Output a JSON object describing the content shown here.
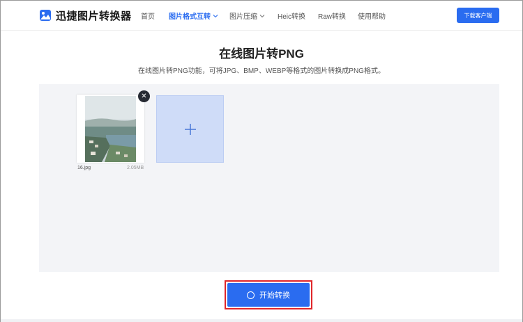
{
  "header": {
    "logo_text": "迅捷图片转换器",
    "nav": [
      {
        "label": "首页",
        "active": false,
        "has_dropdown": false
      },
      {
        "label": "图片格式互转",
        "active": true,
        "has_dropdown": true
      },
      {
        "label": "图片压缩",
        "active": false,
        "has_dropdown": true
      },
      {
        "label": "Heic转换",
        "active": false,
        "has_dropdown": false
      },
      {
        "label": "Raw转换",
        "active": false,
        "has_dropdown": false
      },
      {
        "label": "使用帮助",
        "active": false,
        "has_dropdown": false
      }
    ],
    "download_label": "下载客户端"
  },
  "page": {
    "title": "在线图片转PNG",
    "subtitle": "在线图片转PNG功能，可将JPG、BMP、WEBP等格式的图片转换成PNG格式。"
  },
  "files": [
    {
      "name": "16.jpg",
      "size": "2.05MB"
    }
  ],
  "icons": {
    "logo": "image-logo-icon",
    "close": "close-icon",
    "add": "plus-icon",
    "start": "ring-icon",
    "dropdown": "chevron-down-icon"
  },
  "actions": {
    "start_label": "开始转换"
  },
  "colors": {
    "accent": "#2a6cf0",
    "highlight": "#e0262a",
    "upload_bg": "#f3f4f7",
    "add_tile": "#cfdcf8"
  }
}
